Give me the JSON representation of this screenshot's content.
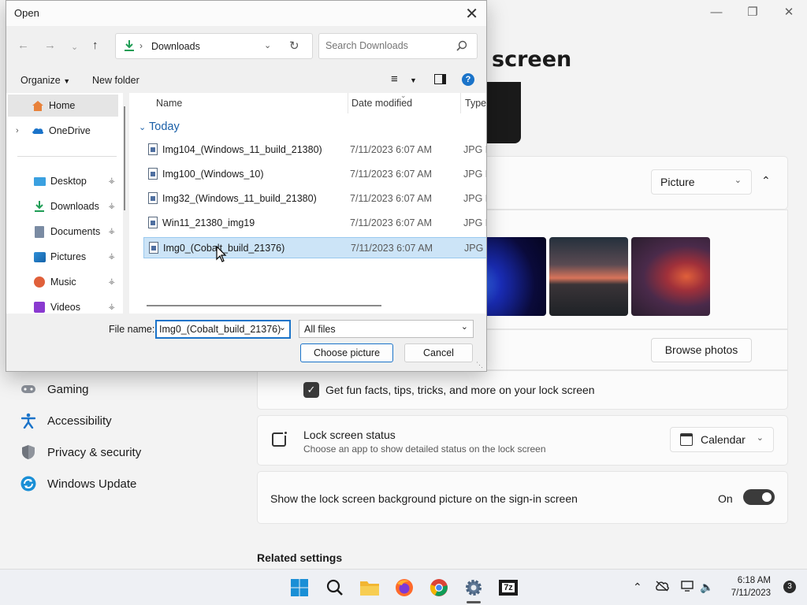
{
  "settings": {
    "page_title": "screen",
    "background_dropdown": "Picture",
    "browse_button": "Browse photos",
    "fun_facts_label": "Get fun facts, tips, tricks, and more on your lock screen",
    "lock_status": {
      "title": "Lock screen status",
      "subtitle": "Choose an app to show detailed status on the lock screen",
      "dropdown": "Calendar"
    },
    "signin_label": "Show the lock screen background picture on the sign-in screen",
    "signin_state": "On",
    "related_settings": "Related settings",
    "nav": [
      {
        "label": "Gaming",
        "icon": "gamepad-icon"
      },
      {
        "label": "Accessibility",
        "icon": "accessibility-icon"
      },
      {
        "label": "Privacy & security",
        "icon": "shield-icon"
      },
      {
        "label": "Windows Update",
        "icon": "update-icon"
      }
    ]
  },
  "dialog": {
    "title": "Open",
    "breadcrumb": "Downloads",
    "search_placeholder": "Search Downloads",
    "organize": "Organize",
    "new_folder": "New folder",
    "nav_pane": [
      {
        "label": "Home",
        "icon": "home-icon"
      },
      {
        "label": "OneDrive",
        "icon": "cloud-icon"
      },
      {
        "label": "Desktop",
        "icon": "desktop-icon"
      },
      {
        "label": "Downloads",
        "icon": "download-icon"
      },
      {
        "label": "Documents",
        "icon": "documents-icon"
      },
      {
        "label": "Pictures",
        "icon": "pictures-icon"
      },
      {
        "label": "Music",
        "icon": "music-icon"
      },
      {
        "label": "Videos",
        "icon": "videos-icon"
      }
    ],
    "columns": {
      "name": "Name",
      "date": "Date modified",
      "type": "Type"
    },
    "group": "Today",
    "files": [
      {
        "name": "Img104_(Windows_11_build_21380)",
        "date": "7/11/2023 6:07 AM",
        "type": "JPG F"
      },
      {
        "name": "Img100_(Windows_10)",
        "date": "7/11/2023 6:07 AM",
        "type": "JPG F"
      },
      {
        "name": "Img32_(Windows_11_build_21380)",
        "date": "7/11/2023 6:07 AM",
        "type": "JPG F"
      },
      {
        "name": "Win11_21380_img19",
        "date": "7/11/2023 6:07 AM",
        "type": "JPG F"
      },
      {
        "name": "Img0_(Cobalt_build_21376)",
        "date": "7/11/2023 6:07 AM",
        "type": "JPG F"
      }
    ],
    "file_name_label": "File name:",
    "file_name_value": "Img0_(Cobalt_build_21376)",
    "file_type": "All files",
    "choose_button": "Choose picture",
    "cancel_button": "Cancel"
  },
  "taskbar": {
    "time": "6:18 AM",
    "date": "7/11/2023",
    "notifications": "3",
    "apps": [
      "windows-start-icon",
      "search-icon",
      "file-explorer-icon",
      "firefox-icon",
      "chrome-icon",
      "settings-icon",
      "7zip-icon"
    ],
    "seven_zip_label": "7z"
  }
}
